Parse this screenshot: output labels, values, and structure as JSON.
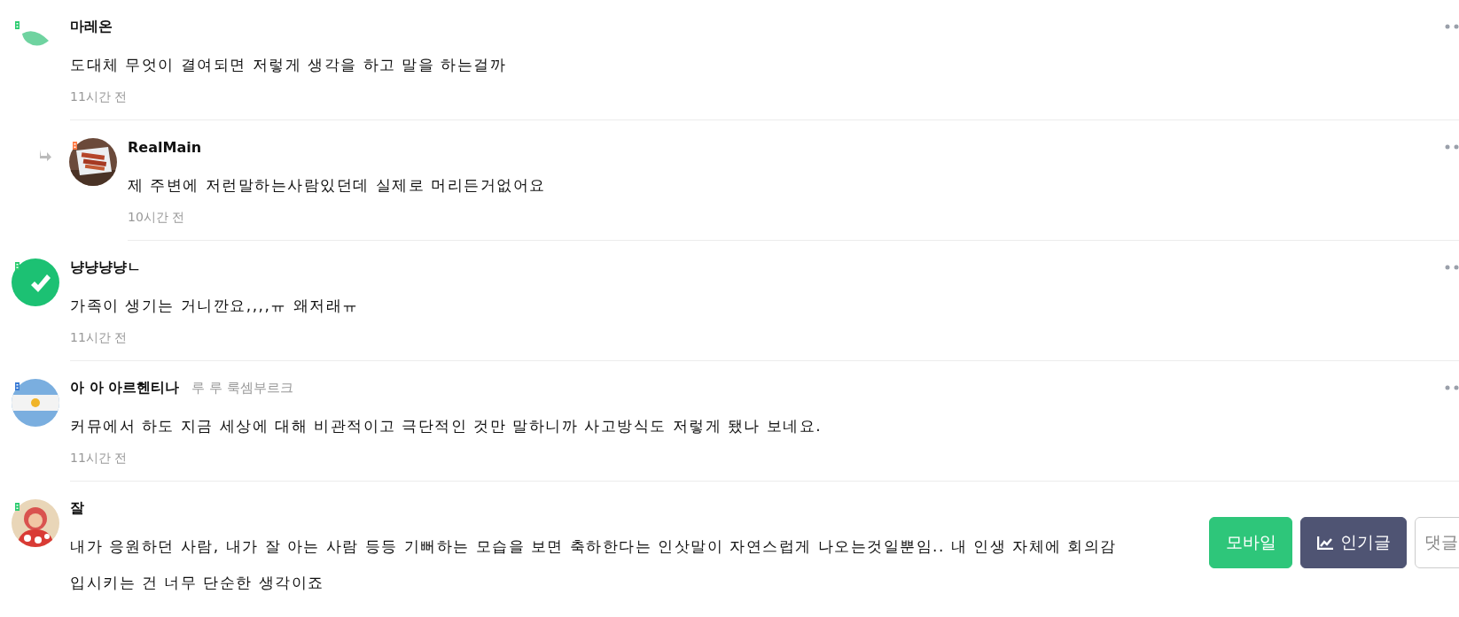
{
  "comments": [
    {
      "author": "마레온",
      "color": "#2ecc71",
      "avatar": {
        "kind": "leaf"
      },
      "reply": false,
      "lines": [
        "도대체 무엇이 결여되면 저렇게 생각을 하고 말을 하는걸까"
      ],
      "time": "11시간 전"
    },
    {
      "author": "RealMain",
      "color": "#ff7a45",
      "avatar": {
        "kind": "picture"
      },
      "reply": true,
      "lines": [
        "제 주변에 저런말하는사람있던데 실제로 머리든거없어요"
      ],
      "time": "10시간 전"
    },
    {
      "author": "냥냥냥냥ㄴ",
      "color": "#2ecc71",
      "avatar": {
        "kind": "check"
      },
      "reply": false,
      "lines": [
        "가족이 생기는 거니깐요,,,,ㅠ 왜저래ㅠ"
      ],
      "time": "11시간 전"
    },
    {
      "author": "아 아 아르헨티나",
      "subtitle": "루 루 룩셈부르크",
      "color": "#3a7bd5",
      "avatar": {
        "kind": "flag"
      },
      "reply": false,
      "lines": [
        " 커뮤에서 하도 지금 세상에 대해 비관적이고 극단적인 것만 말하니까 사고방식도 저렇게 됐나 보네요."
      ],
      "time": "11시간 전"
    },
    {
      "author": "잘",
      "color": "#2ecc71",
      "avatar": {
        "kind": "figure"
      },
      "reply": false,
      "lines": [
        "내가 응원하던 사람, 내가 잘 아는 사람 등등 기뻐하는 모습을 보면 축하한다는 인삿말이 자연스럽게 나오는것일뿐임.. 내 인생 자체에 회의감",
        "입시키는 건 너무 단순한 생각이죠"
      ]
    }
  ],
  "floating_buttons": [
    {
      "label": "모바일",
      "kind": "mobile"
    },
    {
      "label": "인기글",
      "kind": "popular"
    },
    {
      "label": "댓글",
      "kind": "comment"
    }
  ]
}
